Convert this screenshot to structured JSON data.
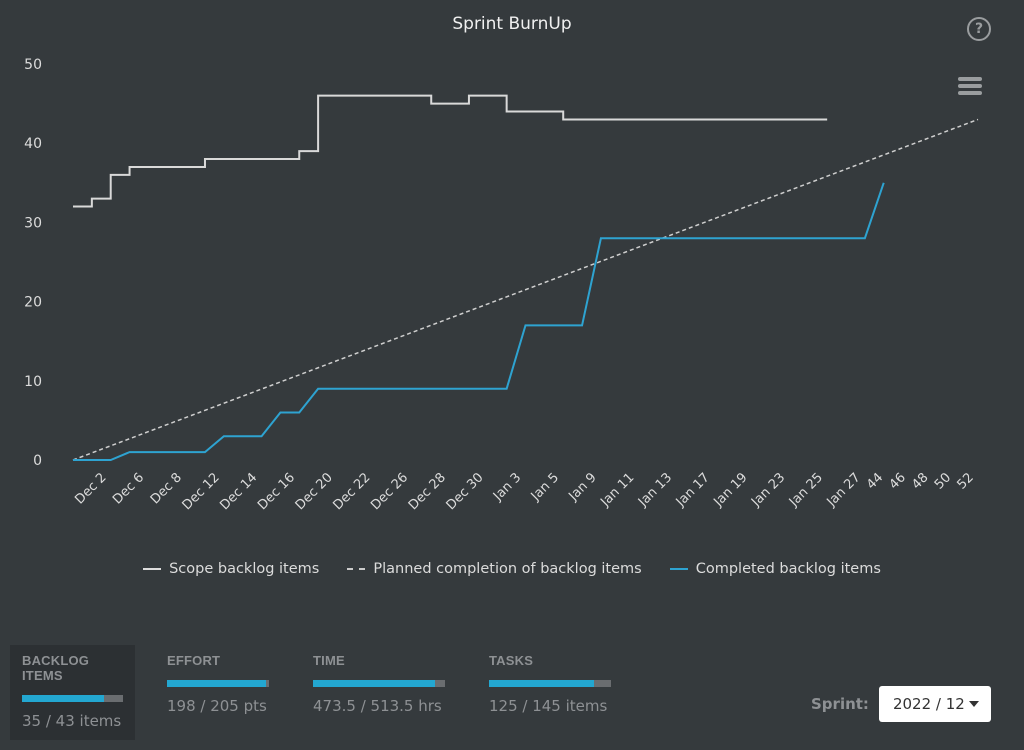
{
  "header": {
    "title": "Sprint BurnUp",
    "help_icon": "question-circle-icon",
    "menu_icon": "hamburger-menu-icon"
  },
  "chart_data": {
    "type": "line",
    "title": "Sprint BurnUp",
    "xlabel": "",
    "ylabel": "",
    "ylim": [
      0,
      50
    ],
    "yticks": [
      0,
      10,
      20,
      30,
      40,
      50
    ],
    "x_count": 49,
    "x_tick_labels": [
      {
        "index": 2,
        "label": "Dec 2"
      },
      {
        "index": 4,
        "label": "Dec 6"
      },
      {
        "index": 6,
        "label": "Dec 8"
      },
      {
        "index": 8,
        "label": "Dec 12"
      },
      {
        "index": 10,
        "label": "Dec 14"
      },
      {
        "index": 12,
        "label": "Dec 16"
      },
      {
        "index": 14,
        "label": "Dec 20"
      },
      {
        "index": 16,
        "label": "Dec 22"
      },
      {
        "index": 18,
        "label": "Dec 26"
      },
      {
        "index": 20,
        "label": "Dec 28"
      },
      {
        "index": 22,
        "label": "Dec 30"
      },
      {
        "index": 24,
        "label": "Jan 3"
      },
      {
        "index": 26,
        "label": "Jan 5"
      },
      {
        "index": 28,
        "label": "Jan 9"
      },
      {
        "index": 30,
        "label": "Jan 11"
      },
      {
        "index": 32,
        "label": "Jan 13"
      },
      {
        "index": 34,
        "label": "Jan 17"
      },
      {
        "index": 36,
        "label": "Jan 19"
      },
      {
        "index": 38,
        "label": "Jan 23"
      },
      {
        "index": 40,
        "label": "Jan 25"
      },
      {
        "index": 42,
        "label": "Jan 27"
      },
      {
        "index": 44,
        "label": "44"
      },
      {
        "index": 46,
        "label": "46"
      },
      {
        "index": 48,
        "label": "48"
      }
    ],
    "x_tick_labels_note": "",
    "series": [
      {
        "name": "Scope backlog items",
        "style": "step",
        "color": "#d9d9d9",
        "points": [
          [
            0,
            32
          ],
          [
            1,
            33
          ],
          [
            2,
            36
          ],
          [
            3,
            37
          ],
          [
            7,
            38
          ],
          [
            12,
            39
          ],
          [
            13,
            46
          ],
          [
            19,
            45
          ],
          [
            21,
            46
          ],
          [
            23,
            44
          ],
          [
            26,
            43
          ],
          [
            40,
            43
          ]
        ]
      },
      {
        "name": "Planned completion of backlog items",
        "style": "dashed",
        "color": "#cfcfcf",
        "points": [
          [
            0,
            0
          ],
          [
            48,
            43
          ]
        ]
      },
      {
        "name": "Completed backlog items",
        "style": "line",
        "color": "#2ea3d1",
        "points": [
          [
            0,
            0
          ],
          [
            2,
            0
          ],
          [
            3,
            1
          ],
          [
            7,
            1
          ],
          [
            8,
            3
          ],
          [
            10,
            3
          ],
          [
            11,
            6
          ],
          [
            12,
            6
          ],
          [
            13,
            9
          ],
          [
            23,
            9
          ],
          [
            24,
            17
          ],
          [
            27,
            17
          ],
          [
            28,
            28
          ],
          [
            42,
            28
          ],
          [
            43,
            35
          ]
        ]
      }
    ],
    "legend": "bottom",
    "grid": false
  },
  "legend_items": [
    {
      "label": "Scope backlog items"
    },
    {
      "label": "Planned completion of backlog items"
    },
    {
      "label": "Completed backlog items"
    }
  ],
  "stats": [
    {
      "label": "BACKLOG ITEMS",
      "value": "35 / 43 items",
      "progress": 0.814,
      "active": true
    },
    {
      "label": "EFFORT",
      "value": "198 / 205 pts",
      "progress": 0.966,
      "active": false
    },
    {
      "label": "TIME",
      "value": "473.5 / 513.5 hrs",
      "progress": 0.922,
      "active": false
    },
    {
      "label": "TASKS",
      "value": "125 / 145 items",
      "progress": 0.862,
      "active": false
    }
  ],
  "sprint": {
    "label": "Sprint:",
    "selected": "2022 / 12"
  }
}
